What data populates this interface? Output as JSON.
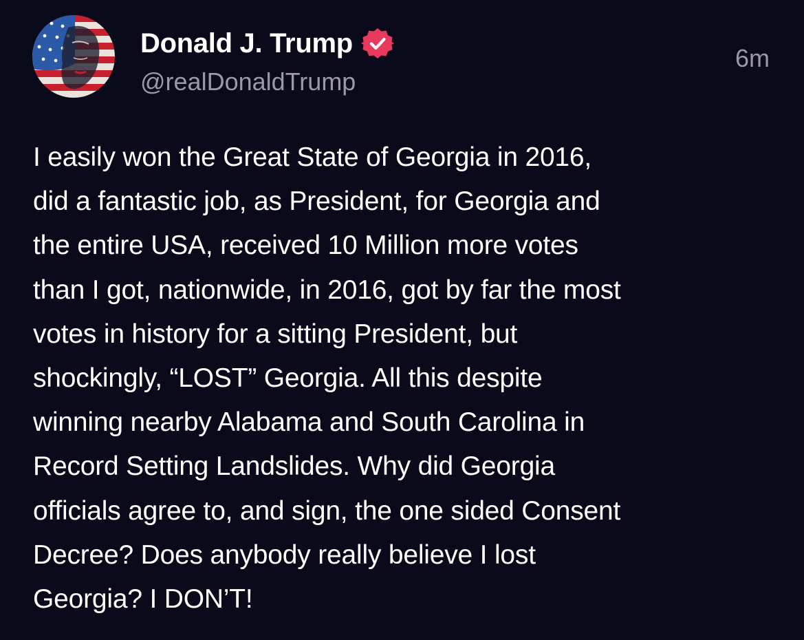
{
  "author": {
    "display_name": "Donald J. Trump",
    "handle": "@realDonaldTrump",
    "verified": true,
    "avatar_icon": "avatar-flag-portrait"
  },
  "post": {
    "timestamp": "6m",
    "lines": [
      "I easily won the Great State of Georgia in 2016,",
      "did a fantastic job, as President, for Georgia and",
      "the entire USA, received 10 Million more votes",
      "than I got, nationwide, in 2016, got by far the most",
      "votes in history for a sitting President, but",
      "shockingly, “LOST” Georgia. All this despite",
      "winning nearby Alabama and South Carolina in",
      "Record Setting Landslides. Why did Georgia",
      "officials agree to, and sign, the one sided Consent",
      "Decree? Does anybody really believe I lost",
      "Georgia? I DON’T!"
    ]
  },
  "colors": {
    "background": "#0b0a1a",
    "text": "#ffffff",
    "muted": "#9a99a8",
    "verified_badge": "#e83a5e"
  }
}
